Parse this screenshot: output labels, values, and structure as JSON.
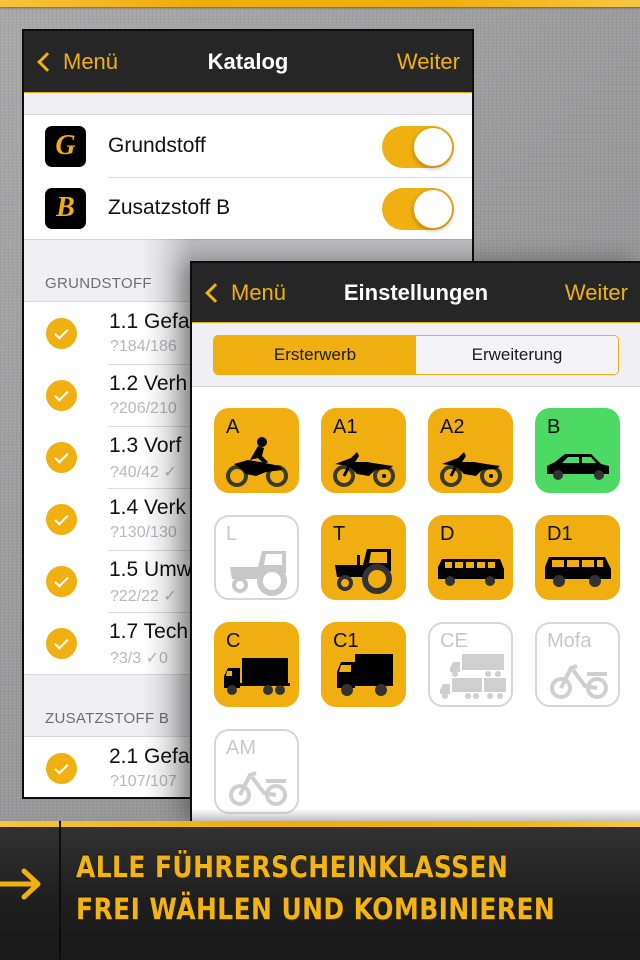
{
  "colors": {
    "accent": "#f0b012",
    "navbar_bg": "#262626",
    "class_active": "#f0ae11",
    "class_selected_green": "#4cd964",
    "class_disabled_border": "#d6d6d6"
  },
  "katalog": {
    "nav": {
      "back_label": "Menü",
      "title": "Katalog",
      "next_label": "Weiter",
      "back_icon": "chevron-left-icon"
    },
    "toggles": [
      {
        "badge": "G",
        "label": "Grundstoff",
        "on": true
      },
      {
        "badge": "B",
        "label": "Zusatzstoff B",
        "on": true
      }
    ],
    "sections": [
      {
        "header": "GRUNDSTOFF",
        "items": [
          {
            "title": "1.1 Gefa",
            "sub": "?184/186",
            "checked": true
          },
          {
            "title": "1.2 Verh",
            "sub": "?206/210",
            "checked": true
          },
          {
            "title": "1.3 Vorf",
            "sub": "?40/42 ✓",
            "checked": true
          },
          {
            "title": "1.4 Verk",
            "sub": "?130/130",
            "checked": true
          },
          {
            "title": "1.5 Umw",
            "sub": "?22/22 ✓",
            "checked": true
          },
          {
            "title": "1.7 Tech",
            "sub": "?3/3 ✓0",
            "checked": true
          }
        ]
      },
      {
        "header": "ZUSATZSTOFF B",
        "items": [
          {
            "title": "2.1 Gefa",
            "sub": "?107/107",
            "checked": true
          }
        ]
      }
    ]
  },
  "settings": {
    "nav": {
      "back_label": "Menü",
      "title": "Einstellungen",
      "next_label": "Weiter",
      "back_icon": "chevron-left-icon"
    },
    "segments": [
      {
        "label": "Ersterwerb",
        "active": true
      },
      {
        "label": "Erweiterung",
        "active": false
      }
    ],
    "classes": [
      {
        "label": "A",
        "icon": "motorcycle-rider-icon",
        "state": "active"
      },
      {
        "label": "A1",
        "icon": "motorcycle-icon",
        "state": "active"
      },
      {
        "label": "A2",
        "icon": "motorcycle-icon",
        "state": "active"
      },
      {
        "label": "B",
        "icon": "car-icon",
        "state": "selected"
      },
      {
        "label": "L",
        "icon": "tractor-icon",
        "state": "disabled"
      },
      {
        "label": "T",
        "icon": "tractor-icon",
        "state": "active"
      },
      {
        "label": "D",
        "icon": "bus-icon",
        "state": "active"
      },
      {
        "label": "D1",
        "icon": "minibus-icon",
        "state": "active"
      },
      {
        "label": "C",
        "icon": "truck-icon",
        "state": "active"
      },
      {
        "label": "C1",
        "icon": "small-truck-icon",
        "state": "active"
      },
      {
        "label": "CE",
        "icon": "truck-trailer-icon",
        "state": "disabled"
      },
      {
        "label": "Mofa",
        "icon": "moped-icon",
        "state": "disabled"
      },
      {
        "label": "AM",
        "icon": "moped-icon",
        "state": "disabled"
      }
    ]
  },
  "banner": {
    "arrow_icon": "arrow-right-icon",
    "line1": "ALLE FÜHRERSCHEINKLASSEN",
    "line2": "FREI WÄHLEN UND KOMBINIEREN"
  }
}
